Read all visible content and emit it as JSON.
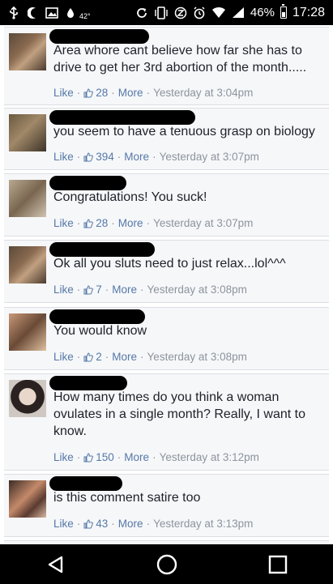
{
  "status_bar": {
    "temperature": "42°",
    "battery_percent": "46%",
    "time": "17:28"
  },
  "comments": [
    {
      "text": "Area whore cant believe how far she has to drive to get her 3rd abortion of the month.....",
      "like_label": "Like",
      "like_count": "28",
      "more_label": "More",
      "timestamp": "Yesterday at 3:04pm"
    },
    {
      "text": "you seem to have a tenuous grasp on biology",
      "like_label": "Like",
      "like_count": "394",
      "more_label": "More",
      "timestamp": "Yesterday at 3:07pm"
    },
    {
      "text": "Congratulations! You suck!",
      "like_label": "Like",
      "like_count": "28",
      "more_label": "More",
      "timestamp": "Yesterday at 3:07pm"
    },
    {
      "text": "Ok all you sluts need to just relax...lol^^^",
      "like_label": "Like",
      "like_count": "7",
      "more_label": "More",
      "timestamp": "Yesterday at 3:08pm"
    },
    {
      "text": "You would know",
      "like_label": "Like",
      "like_count": "2",
      "more_label": "More",
      "timestamp": "Yesterday at 3:08pm"
    },
    {
      "text": "How many times do you think a woman ovulates in a single month? Really, I want to know.",
      "like_label": "Like",
      "like_count": "150",
      "more_label": "More",
      "timestamp": "Yesterday at 3:12pm"
    },
    {
      "text": "is this comment satire too",
      "like_label": "Like",
      "like_count": "43",
      "more_label": "More",
      "timestamp": "Yesterday at 3:13pm"
    }
  ],
  "colors": {
    "link": "#5578a8",
    "meta": "#8d949e",
    "comment_bg": "#f6f7f9"
  }
}
